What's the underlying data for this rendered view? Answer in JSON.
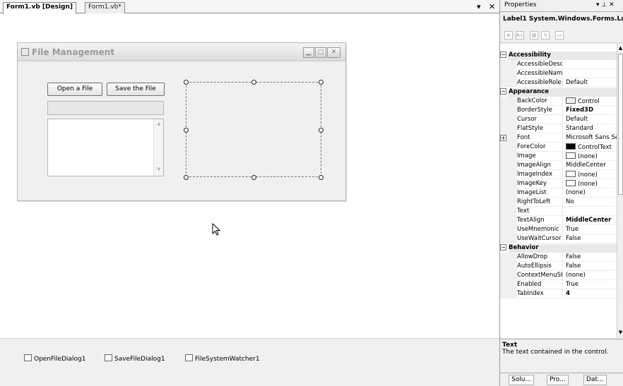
{
  "designer": {
    "tabs": [
      {
        "label": "Form1.vb [Design]"
      },
      {
        "label": "Form1.vb*"
      }
    ],
    "tab_controls": {
      "dropdown": "▾",
      "close": "✕"
    }
  },
  "form": {
    "title": "File Management",
    "buttons": {
      "open": "Open a File",
      "save": "Save the File"
    }
  },
  "tray": {
    "items": [
      {
        "label": "OpenFileDialog1"
      },
      {
        "label": "SaveFileDialog1"
      },
      {
        "label": "FileSystemWatcher1"
      }
    ]
  },
  "properties": {
    "title": "Properties",
    "title_controls": "▾ ⊥ ✕",
    "object": "Label1 System.Windows.Forms.Lab",
    "categories": [
      {
        "name": "Accessibility",
        "rows": [
          {
            "name": "AccessibleDescr",
            "value": ""
          },
          {
            "name": "AccessibleName",
            "value": ""
          },
          {
            "name": "AccessibleRole",
            "value": "Default"
          }
        ]
      },
      {
        "name": "Appearance",
        "rows": [
          {
            "name": "BackColor",
            "value": "Control",
            "swatch": "#f0f0f0"
          },
          {
            "name": "BorderStyle",
            "value": "Fixed3D",
            "bold": true
          },
          {
            "name": "Cursor",
            "value": "Default"
          },
          {
            "name": "FlatStyle",
            "value": "Standard"
          },
          {
            "name": "Font",
            "value": "Microsoft Sans Se",
            "expand": true
          },
          {
            "name": "ForeColor",
            "value": "ControlText",
            "swatch": "#000000"
          },
          {
            "name": "Image",
            "value": "(none)",
            "swatch": "#ffffff"
          },
          {
            "name": "ImageAlign",
            "value": "MiddleCenter"
          },
          {
            "name": "ImageIndex",
            "value": "(none)",
            "swatch": "#ffffff"
          },
          {
            "name": "ImageKey",
            "value": "(none)",
            "swatch": "#ffffff"
          },
          {
            "name": "ImageList",
            "value": "(none)"
          },
          {
            "name": "RightToLeft",
            "value": "No"
          },
          {
            "name": "Text",
            "value": ""
          },
          {
            "name": "TextAlign",
            "value": "MiddleCenter",
            "bold": true
          },
          {
            "name": "UseMnemonic",
            "value": "True"
          },
          {
            "name": "UseWaitCursor",
            "value": "False"
          }
        ]
      },
      {
        "name": "Behavior",
        "rows": [
          {
            "name": "AllowDrop",
            "value": "False"
          },
          {
            "name": "AutoEllipsis",
            "value": "False"
          },
          {
            "name": "ContextMenuStr",
            "value": "(none)"
          },
          {
            "name": "Enabled",
            "value": "True"
          },
          {
            "name": "TabIndex",
            "value": "4",
            "bold": true
          }
        ]
      }
    ],
    "description": {
      "title": "Text",
      "text": "The text contained in the control."
    },
    "bottom_tabs": [
      {
        "label": "Solu..."
      },
      {
        "label": "Pro..."
      },
      {
        "label": "Dat..."
      }
    ]
  },
  "colors": {
    "form_bg": "#f0f0f0",
    "panel_bg": "#f0f0f0",
    "tray_bg": "#f0f0f0"
  }
}
